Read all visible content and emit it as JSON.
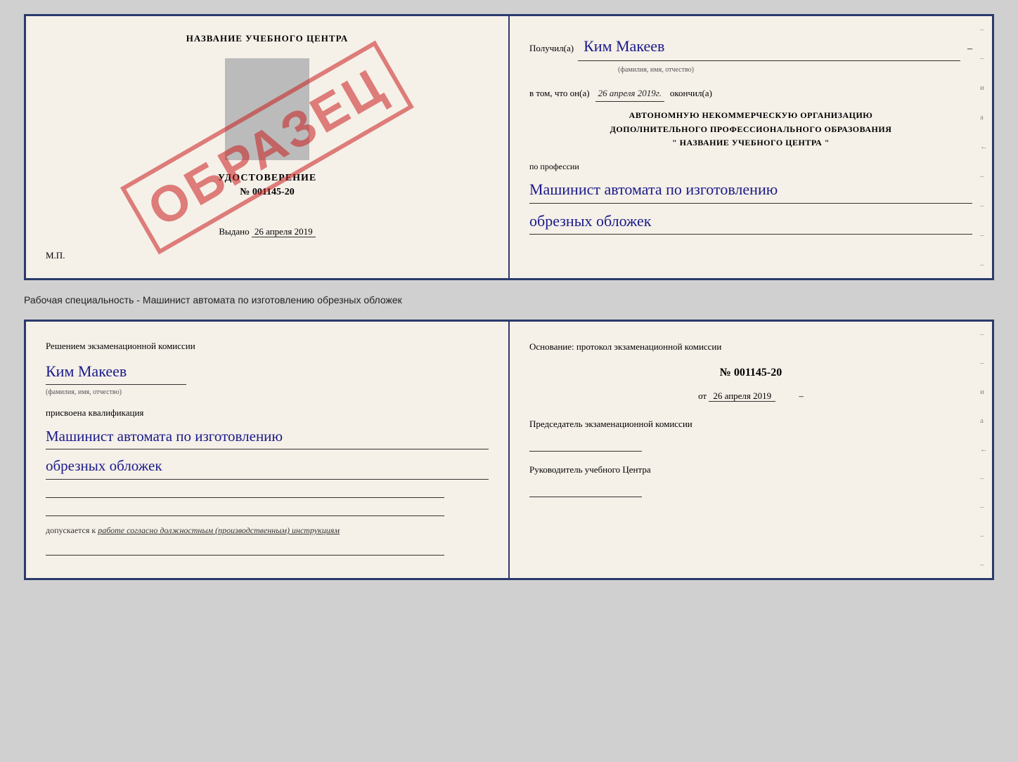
{
  "top_doc": {
    "left": {
      "school_name": "НАЗВАНИЕ УЧЕБНОГО ЦЕНТРА",
      "stamp": "ОБРАЗЕЦ",
      "udostoverenie": "УДОСТОВЕРЕНИЕ",
      "number": "№ 001145-20",
      "vydano": "Выдано",
      "vydano_date": "26 апреля 2019",
      "mp": "М.П."
    },
    "right": {
      "poluchil": "Получил(а)",
      "name_handwritten": "Ким Макеев",
      "dash": "–",
      "fio_hint": "(фамилия, имя, отчество)",
      "vtom": "в том, что он(а)",
      "date_handwritten": "26 апреля 2019г.",
      "okonchil": "окончил(а)",
      "org_line1": "АВТОНОМНУЮ НЕКОММЕРЧЕСКУЮ ОРГАНИЗАЦИЮ",
      "org_line2": "ДОПОЛНИТЕЛЬНОГО ПРОФЕССИОНАЛЬНОГО ОБРАЗОВАНИЯ",
      "org_line3": "\"   НАЗВАНИЕ УЧЕБНОГО ЦЕНТРА   \"",
      "profession_label": "по профессии",
      "profession_line1": "Машинист автомата по изготовлению",
      "profession_line2": "обрезных обложек"
    }
  },
  "subtitle": "Рабочая специальность - Машинист автомата по изготовлению обрезных обложек",
  "bottom_doc": {
    "left": {
      "resheniem": "Решением экзаменационной комиссии",
      "name_handwritten": "Ким Макеев",
      "fio_hint": "(фамилия, имя, отчество)",
      "prisvoena": "присвоена квалификация",
      "qual_line1": "Машинист автомата по изготовлению",
      "qual_line2": "обрезных обложек",
      "dopuskaetsya": "допускается к",
      "dopusk_text": "работе согласно должностным (производственным) инструкциям"
    },
    "right": {
      "osnovanie": "Основание: протокол экзаменационной комиссии",
      "protokol_number": "№  001145-20",
      "protokol_ot": "от",
      "protokol_date": "26 апреля 2019",
      "predsedatel_label": "Председатель экзаменационной комиссии",
      "rukovoditel_label": "Руководитель учебного Центра"
    }
  }
}
